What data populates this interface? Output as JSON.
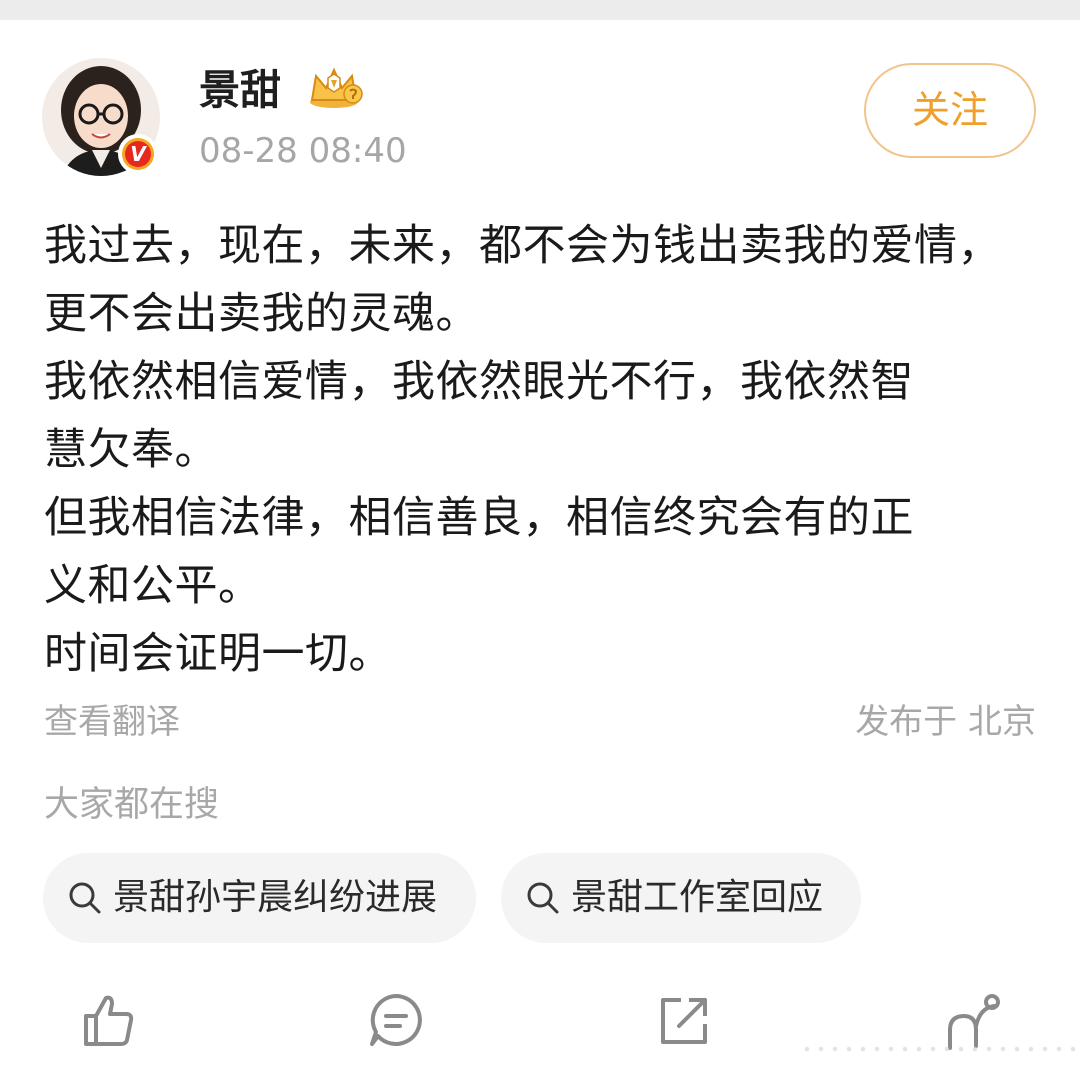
{
  "post": {
    "username": "景甜",
    "timestamp": "08-28 08:40",
    "follow_label": "关注",
    "verified_badge": "V",
    "body_lines": [
      "我过去，现在，未来，都不会为钱出卖我的爱情，",
      "更不会出卖我的灵魂。",
      "我依然相信爱情，我依然眼光不行，我依然智",
      "慧欠奉。",
      "但我相信法律，相信善良，相信终究会有的正",
      "义和公平。",
      "时间会证明一切。"
    ],
    "translate_label": "查看翻译",
    "location": "发布于 北京"
  },
  "trending": {
    "title": "大家都在搜",
    "items": [
      {
        "label": "景甜孙宇晨纠纷进展",
        "icon": "search-icon"
      },
      {
        "label": "景甜工作室回应",
        "icon": "search-icon"
      }
    ]
  },
  "actions": [
    {
      "name": "like",
      "icon": "thumb-up-icon"
    },
    {
      "name": "comment",
      "icon": "comment-icon"
    },
    {
      "name": "share",
      "icon": "share-icon"
    },
    {
      "name": "more",
      "icon": "connect-icon"
    }
  ],
  "colors": {
    "follow_text": "#f09f2a",
    "follow_border": "#f2c48d",
    "muted_text": "#a8a8a8",
    "chip_bg": "#f4f4f4",
    "verified_red": "#e8271f",
    "verified_gold": "#f5a623"
  }
}
